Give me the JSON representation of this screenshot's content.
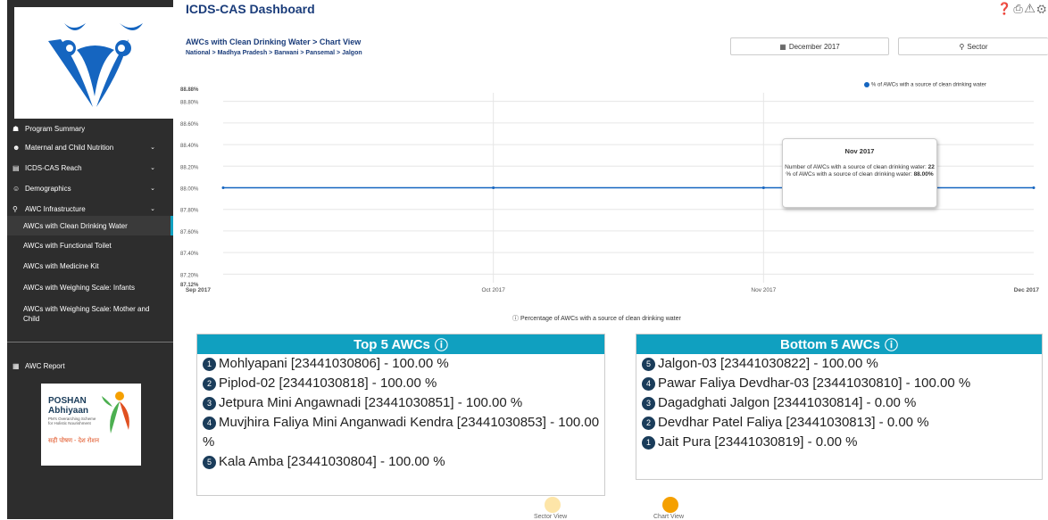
{
  "app": {
    "title": "ICDS-CAS Dashboard"
  },
  "sidebar": {
    "items": [
      {
        "label": "Program Summary",
        "icon": "home-icon"
      },
      {
        "label": "Maternal and Child Nutrition",
        "icon": "person-icon"
      },
      {
        "label": "ICDS-CAS Reach",
        "icon": "bar-chart-icon"
      },
      {
        "label": "Demographics",
        "icon": "people-icon"
      },
      {
        "label": "AWC Infrastructure",
        "icon": "map-pin-icon"
      }
    ],
    "sub_items": [
      "AWCs with Clean Drinking Water",
      "AWCs with Functional Toilet",
      "AWCs with Medicine Kit",
      "AWCs with Weighing Scale: Infants",
      "AWCs with Weighing Scale: Mother and Child"
    ],
    "report": {
      "label": "AWC Report",
      "icon": "table-icon"
    },
    "poshan": {
      "title_1": "POSHAN",
      "title_2": "Abhiyaan",
      "tagline": "PM's Overarching Scheme for Holistic Nourishment",
      "slogan": "सही पोषण - देश रोशन"
    }
  },
  "header": {
    "subtitle": "AWCs with Clean Drinking Water > Chart View",
    "breadcrumb": "National > Madhya Pradesh > Barwani > Pansemal > Jalgon",
    "date_filter": "December 2017",
    "sector_filter": "Sector"
  },
  "chart_data": {
    "type": "line",
    "x": [
      "Sep 2017",
      "Oct 2017",
      "Nov 2017",
      "Dec 2017"
    ],
    "series": [
      {
        "name": "% of AWCs with a source of clean drinking water",
        "values": [
          88.0,
          88.0,
          88.0,
          88.0
        ]
      }
    ],
    "y_ticks": [
      "88.88%",
      "88.80%",
      "88.60%",
      "88.40%",
      "88.20%",
      "88.00%",
      "87.80%",
      "87.60%",
      "87.40%",
      "87.20%",
      "87.12%"
    ],
    "ylim": [
      87.12,
      88.88
    ],
    "grid": true,
    "legend": "top-right",
    "line_color": "#1565c0",
    "caption": "Percentage of AWCs with a source of clean drinking water",
    "tooltip": {
      "title": "Nov 2017",
      "line1": "Number of AWCs with a source of clean drinking water:",
      "value1": "22",
      "line2": "% of AWCs with a source of clean drinking water:",
      "value2": "88.00%"
    }
  },
  "top5": {
    "title": "Top 5 AWCs",
    "rows": [
      {
        "rank": "1",
        "text": "Mohlyapani [23441030806] - 100.00 %"
      },
      {
        "rank": "2",
        "text": "Piplod-02 [23441030818] - 100.00 %"
      },
      {
        "rank": "3",
        "text": "Jetpura Mini Angawnadi [23441030851] - 100.00 %"
      },
      {
        "rank": "4",
        "text": "Muvjhira Faliya Mini Anganwadi Kendra [23441030853] - 100.00 %"
      },
      {
        "rank": "5",
        "text": "Kala Amba [23441030804] - 100.00 %"
      }
    ]
  },
  "bottom5": {
    "title": "Bottom 5 AWCs",
    "rows": [
      {
        "rank": "5",
        "text": "Jalgon-03 [23441030822] - 100.00 %"
      },
      {
        "rank": "4",
        "text": "Pawar Faliya Devdhar-03 [23441030810] - 100.00 %"
      },
      {
        "rank": "3",
        "text": "Dagadghati Jalgon [23441030814] - 0.00 %"
      },
      {
        "rank": "2",
        "text": "Devdhar Patel Faliya [23441030813] - 0.00 %"
      },
      {
        "rank": "1",
        "text": "Jait Pura [23441030819] - 0.00 %"
      }
    ]
  },
  "views": {
    "sector": "Sector View",
    "chart": "Chart View"
  },
  "colors": {
    "accent": "#10a0c0",
    "title": "#1a3c7a",
    "sidebar": "#2d2d2d",
    "line": "#1565c0",
    "view_active": "#f5a000",
    "view_inactive": "#fde5a8"
  }
}
